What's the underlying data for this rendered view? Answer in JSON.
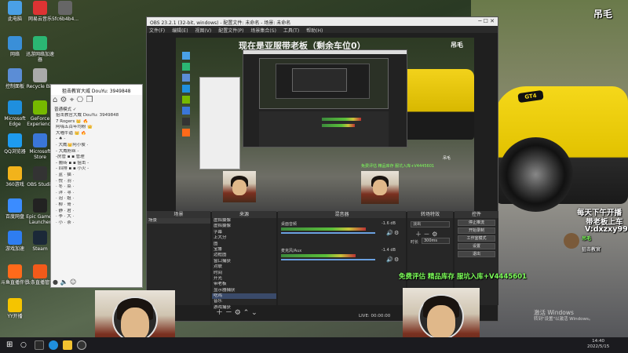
{
  "desktop": {
    "icons": [
      {
        "label": "此电脑",
        "color": "#4aa0e6"
      },
      {
        "label": "网易云音乐",
        "color": "#d33"
      },
      {
        "label": "5fc6b4b4...",
        "color": "#666"
      },
      {
        "label": "网络",
        "color": "#3a8fd8"
      },
      {
        "label": "迅游网络加速器",
        "color": "#2bb673"
      },
      {
        "label": "控制面板",
        "color": "#5b8dd6"
      },
      {
        "label": "Recycle Bin",
        "color": "#aaa"
      },
      {
        "label": "Microsoft Edge",
        "color": "#1f8fde"
      },
      {
        "label": "GeForce Experience",
        "color": "#76b900"
      },
      {
        "label": "QQ浏览器",
        "color": "#1e9bf0"
      },
      {
        "label": "Microsoft Store",
        "color": "#3a76d8"
      },
      {
        "label": "360游戏",
        "color": "#f2b31b"
      },
      {
        "label": "OBS Studio",
        "color": "#333"
      },
      {
        "label": "百度网盘",
        "color": "#3b8cff"
      },
      {
        "label": "Epic Games Launcher",
        "color": "#222"
      },
      {
        "label": "游戏加速",
        "color": "#2e7df0"
      },
      {
        "label": "Steam",
        "color": "#1b2838"
      },
      {
        "label": "斗鱼直播伴侣",
        "color": "#ff6a1a"
      },
      {
        "label": "头条直播管家",
        "color": "#f25a1a"
      },
      {
        "label": "YY开播",
        "color": "#f5c400"
      }
    ]
  },
  "obs": {
    "title": "OBS 23.2.1 (32-bit, windows) - 配置文件: 未命名 - 场景: 未命名",
    "menu": [
      "文件(F)",
      "编辑(E)",
      "视图(V)",
      "配置文件(P)",
      "场景集合(S)",
      "工具(T)",
      "帮助(H)"
    ],
    "preview_title": "现在是亚服带老板（剩余车位0）",
    "docks": {
      "scenes_title": "场景",
      "scenes": [
        "场景"
      ],
      "sources_title": "来源",
      "sources": [
        "虚拟摄像",
        "虚拟摄像",
        "字幕",
        "上大分",
        "图",
        "宝鲁",
        "边框图",
        "窗口捕获",
        "对联",
        "时间",
        "开光",
        "带老板",
        "显示器捕获",
        "吃鸡",
        "音乐",
        "游戏捕获"
      ],
      "mixer_title": "混音器",
      "mixer": [
        {
          "label": "桌面音频",
          "db": "-1.6 dB",
          "level": 0.72
        },
        {
          "label": "麦克风/Aux",
          "db": "-1.4 dB",
          "level": 0.63
        }
      ],
      "transitions_title": "转场特效",
      "transition_type": "淡出",
      "duration_label": "时长",
      "duration_value": "300ms",
      "controls_title": "控件",
      "controls": [
        "停止推流",
        "开始录制",
        "工作室模式",
        "设置",
        "退出"
      ]
    },
    "status": "LIVE: 00:00:00"
  },
  "chat": {
    "title": "狙击教官大威 DouYu: 3949848",
    "subtitle": "普通模式 ✓",
    "lines": [
      "狙击教官大威  DouYu: 3949848",
      "7 Rogers 👑 🔥",
      "阿嗨五百年均粉 👑",
      "大喵牛逼 👑 🔥",
      "- ♠ -",
      "· 大威👑阿小俊 ·",
      "- 大威粉丝 -",
      "-房管 ▪ ▪ 管理",
      "- 搬砖 ▪ ▪ 狙击 -",
      "- 四排 ▪ ▪ 小火 -",
      "· 蓝 · 猫 ·",
      "· 悦 · 羽 ·",
      "· 冬 · 菜 ·",
      "· 洋 · 寻 ·",
      "· 泡 · 姐 ·",
      "· 柳 · 哥 ·",
      "· 静 · 君 ·",
      "· 李 · 大 ·",
      "· 小 · 茶 ·"
    ]
  },
  "overlays": {
    "top_right_name": "吊毛",
    "schedule_1": "每天下午开播",
    "schedule_2": "带老板上车",
    "wechat": "V:dxzxy99",
    "scroll_text": "免费评估 精品库存 服坑入库+V4445601",
    "gift_user": "吊毛",
    "gift_note": "狙击教官"
  },
  "taskbar": {
    "time": "14:40",
    "date": "2022/5/15",
    "icons": [
      "windows-start",
      "search",
      "task-view",
      "edge",
      "explorer",
      "obs",
      "steam",
      "chrome"
    ]
  },
  "watermark": {
    "line1": "激活 Windows",
    "line2": "转到\"设置\"以激活 Windows。"
  }
}
